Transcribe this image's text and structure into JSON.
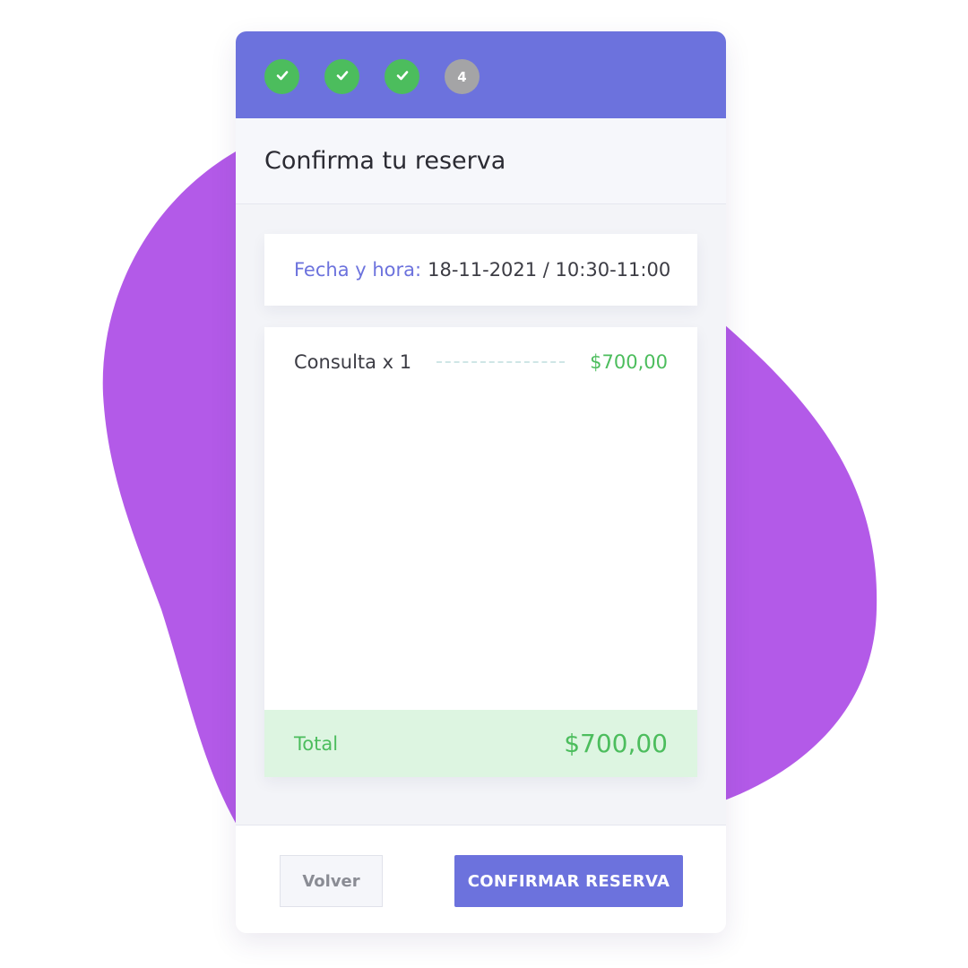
{
  "steps": [
    {
      "state": "done",
      "icon": "check-icon"
    },
    {
      "state": "done",
      "icon": "check-icon"
    },
    {
      "state": "done",
      "icon": "check-icon"
    },
    {
      "state": "current",
      "label": "4"
    }
  ],
  "header": {
    "title": "Confirma tu reserva"
  },
  "booking": {
    "date_label": "Fecha y hora:",
    "date_value": "18-11-2021 / 10:30-11:00"
  },
  "items": [
    {
      "name": "Consulta x 1",
      "price": "$700,00"
    }
  ],
  "total": {
    "label": "Total",
    "value": "$700,00"
  },
  "actions": {
    "back_label": "Volver",
    "confirm_label": "CONFIRMAR RESERVA"
  },
  "colors": {
    "accent": "#6c72dd",
    "success": "#4cbd5d",
    "pending": "#a4a4a6",
    "total_bg": "#ddf5e1",
    "blob": "#b35ae8"
  }
}
